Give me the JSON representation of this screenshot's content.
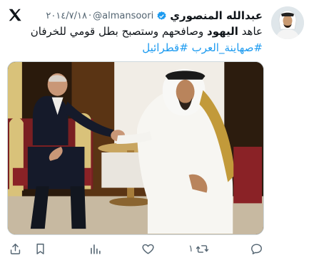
{
  "tweet": {
    "author_name": "عبدالله المنصوري",
    "handle": "@almansoori",
    "date": "٢٠١٤/٧/١٨",
    "separator": "·",
    "text_prefix": "عاهد",
    "text_bold": "اليهود",
    "text_suffix": "وصافحهم وستصبح بطل قومي للخرفان",
    "hashtags": [
      "#صهاينة_العرب",
      "#قطرائيل"
    ],
    "verified": true
  },
  "actions": {
    "reply_count": "",
    "retweet_count": "١",
    "like_count": ""
  },
  "icons": {
    "logo": "x-logo-icon",
    "verified": "verified-badge-icon",
    "reply": "reply-icon",
    "retweet": "retweet-icon",
    "like": "heart-icon",
    "views": "views-icon",
    "bookmark": "bookmark-icon",
    "share": "share-icon"
  },
  "colors": {
    "accent": "#1d9bf0",
    "text": "#0f1419",
    "muted": "#536471"
  }
}
